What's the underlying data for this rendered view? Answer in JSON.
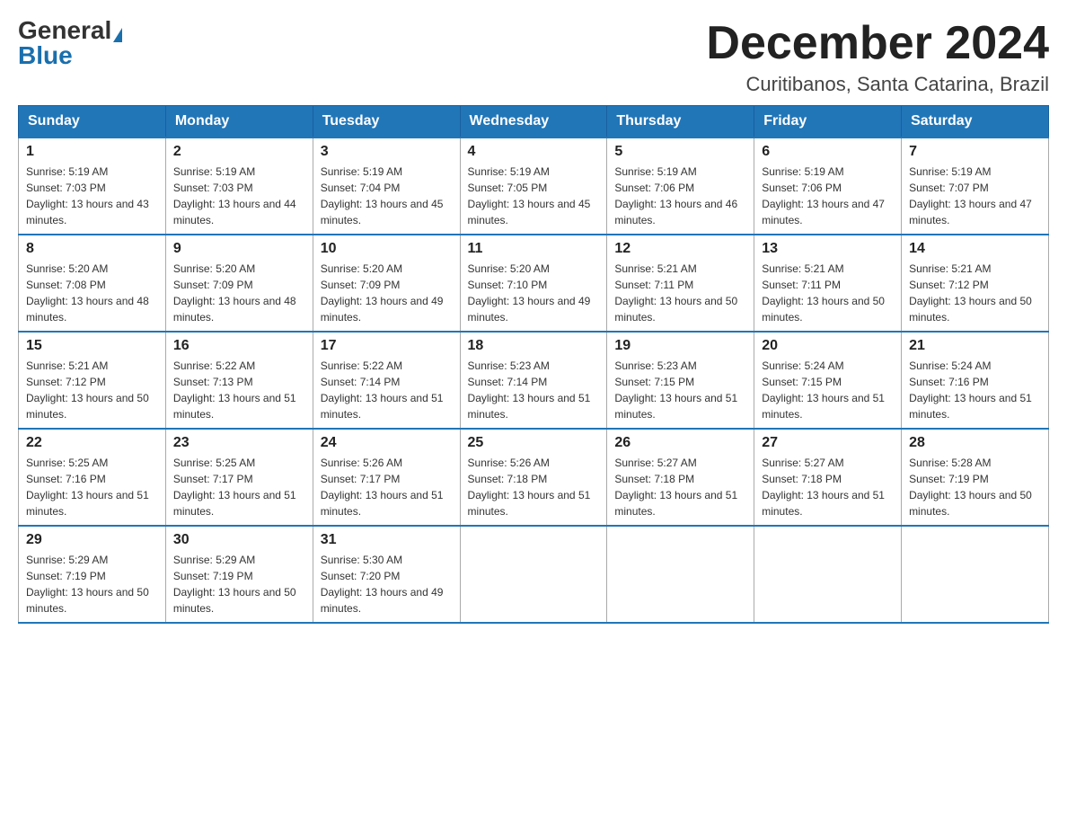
{
  "header": {
    "logo_general": "General",
    "logo_blue": "Blue",
    "month_title": "December 2024",
    "location": "Curitibanos, Santa Catarina, Brazil"
  },
  "days_of_week": [
    "Sunday",
    "Monday",
    "Tuesday",
    "Wednesday",
    "Thursday",
    "Friday",
    "Saturday"
  ],
  "weeks": [
    [
      {
        "day": "1",
        "sunrise": "5:19 AM",
        "sunset": "7:03 PM",
        "daylight": "13 hours and 43 minutes."
      },
      {
        "day": "2",
        "sunrise": "5:19 AM",
        "sunset": "7:03 PM",
        "daylight": "13 hours and 44 minutes."
      },
      {
        "day": "3",
        "sunrise": "5:19 AM",
        "sunset": "7:04 PM",
        "daylight": "13 hours and 45 minutes."
      },
      {
        "day": "4",
        "sunrise": "5:19 AM",
        "sunset": "7:05 PM",
        "daylight": "13 hours and 45 minutes."
      },
      {
        "day": "5",
        "sunrise": "5:19 AM",
        "sunset": "7:06 PM",
        "daylight": "13 hours and 46 minutes."
      },
      {
        "day": "6",
        "sunrise": "5:19 AM",
        "sunset": "7:06 PM",
        "daylight": "13 hours and 47 minutes."
      },
      {
        "day": "7",
        "sunrise": "5:19 AM",
        "sunset": "7:07 PM",
        "daylight": "13 hours and 47 minutes."
      }
    ],
    [
      {
        "day": "8",
        "sunrise": "5:20 AM",
        "sunset": "7:08 PM",
        "daylight": "13 hours and 48 minutes."
      },
      {
        "day": "9",
        "sunrise": "5:20 AM",
        "sunset": "7:09 PM",
        "daylight": "13 hours and 48 minutes."
      },
      {
        "day": "10",
        "sunrise": "5:20 AM",
        "sunset": "7:09 PM",
        "daylight": "13 hours and 49 minutes."
      },
      {
        "day": "11",
        "sunrise": "5:20 AM",
        "sunset": "7:10 PM",
        "daylight": "13 hours and 49 minutes."
      },
      {
        "day": "12",
        "sunrise": "5:21 AM",
        "sunset": "7:11 PM",
        "daylight": "13 hours and 50 minutes."
      },
      {
        "day": "13",
        "sunrise": "5:21 AM",
        "sunset": "7:11 PM",
        "daylight": "13 hours and 50 minutes."
      },
      {
        "day": "14",
        "sunrise": "5:21 AM",
        "sunset": "7:12 PM",
        "daylight": "13 hours and 50 minutes."
      }
    ],
    [
      {
        "day": "15",
        "sunrise": "5:21 AM",
        "sunset": "7:12 PM",
        "daylight": "13 hours and 50 minutes."
      },
      {
        "day": "16",
        "sunrise": "5:22 AM",
        "sunset": "7:13 PM",
        "daylight": "13 hours and 51 minutes."
      },
      {
        "day": "17",
        "sunrise": "5:22 AM",
        "sunset": "7:14 PM",
        "daylight": "13 hours and 51 minutes."
      },
      {
        "day": "18",
        "sunrise": "5:23 AM",
        "sunset": "7:14 PM",
        "daylight": "13 hours and 51 minutes."
      },
      {
        "day": "19",
        "sunrise": "5:23 AM",
        "sunset": "7:15 PM",
        "daylight": "13 hours and 51 minutes."
      },
      {
        "day": "20",
        "sunrise": "5:24 AM",
        "sunset": "7:15 PM",
        "daylight": "13 hours and 51 minutes."
      },
      {
        "day": "21",
        "sunrise": "5:24 AM",
        "sunset": "7:16 PM",
        "daylight": "13 hours and 51 minutes."
      }
    ],
    [
      {
        "day": "22",
        "sunrise": "5:25 AM",
        "sunset": "7:16 PM",
        "daylight": "13 hours and 51 minutes."
      },
      {
        "day": "23",
        "sunrise": "5:25 AM",
        "sunset": "7:17 PM",
        "daylight": "13 hours and 51 minutes."
      },
      {
        "day": "24",
        "sunrise": "5:26 AM",
        "sunset": "7:17 PM",
        "daylight": "13 hours and 51 minutes."
      },
      {
        "day": "25",
        "sunrise": "5:26 AM",
        "sunset": "7:18 PM",
        "daylight": "13 hours and 51 minutes."
      },
      {
        "day": "26",
        "sunrise": "5:27 AM",
        "sunset": "7:18 PM",
        "daylight": "13 hours and 51 minutes."
      },
      {
        "day": "27",
        "sunrise": "5:27 AM",
        "sunset": "7:18 PM",
        "daylight": "13 hours and 51 minutes."
      },
      {
        "day": "28",
        "sunrise": "5:28 AM",
        "sunset": "7:19 PM",
        "daylight": "13 hours and 50 minutes."
      }
    ],
    [
      {
        "day": "29",
        "sunrise": "5:29 AM",
        "sunset": "7:19 PM",
        "daylight": "13 hours and 50 minutes."
      },
      {
        "day": "30",
        "sunrise": "5:29 AM",
        "sunset": "7:19 PM",
        "daylight": "13 hours and 50 minutes."
      },
      {
        "day": "31",
        "sunrise": "5:30 AM",
        "sunset": "7:20 PM",
        "daylight": "13 hours and 49 minutes."
      },
      null,
      null,
      null,
      null
    ]
  ],
  "labels": {
    "sunrise_prefix": "Sunrise: ",
    "sunset_prefix": "Sunset: ",
    "daylight_prefix": "Daylight: "
  }
}
